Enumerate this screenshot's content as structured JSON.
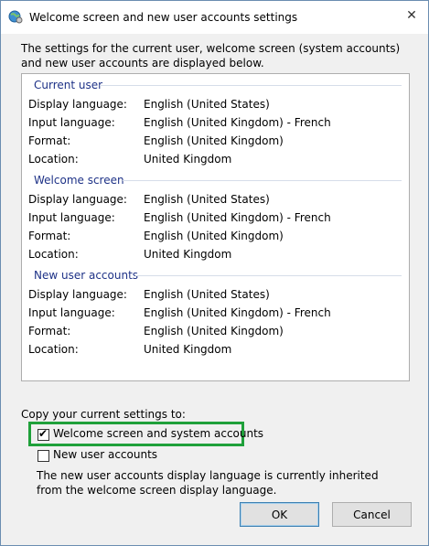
{
  "window": {
    "title": "Welcome screen and new user accounts settings",
    "close_symbol": "✕"
  },
  "intro": "The settings for the current user, welcome screen (system accounts) and new user accounts are displayed below.",
  "sections": [
    {
      "title": "Current user",
      "rows": [
        {
          "label": "Display language:",
          "value": "English (United States)"
        },
        {
          "label": "Input language:",
          "value": "English (United Kingdom) - French"
        },
        {
          "label": "Format:",
          "value": "English (United Kingdom)"
        },
        {
          "label": "Location:",
          "value": "United Kingdom"
        }
      ]
    },
    {
      "title": "Welcome screen",
      "rows": [
        {
          "label": "Display language:",
          "value": "English (United States)"
        },
        {
          "label": "Input language:",
          "value": "English (United Kingdom) - French"
        },
        {
          "label": "Format:",
          "value": "English (United Kingdom)"
        },
        {
          "label": "Location:",
          "value": "United Kingdom"
        }
      ]
    },
    {
      "title": "New user accounts",
      "rows": [
        {
          "label": "Display language:",
          "value": "English (United States)"
        },
        {
          "label": "Input language:",
          "value": "English (United Kingdom) - French"
        },
        {
          "label": "Format:",
          "value": "English (United Kingdom)"
        },
        {
          "label": "Location:",
          "value": "United Kingdom"
        }
      ]
    }
  ],
  "copy": {
    "label": "Copy your current settings to:",
    "welcome_checkbox": {
      "label": "Welcome screen and system accounts",
      "checked": true
    },
    "new_users_checkbox": {
      "label": "New user accounts",
      "checked": false
    },
    "note": "The new user accounts display language is currently inherited from the welcome screen display language."
  },
  "buttons": {
    "ok": "OK",
    "cancel": "Cancel"
  },
  "colors": {
    "section_header": "#1e3287",
    "highlight": "#1fa03a"
  }
}
